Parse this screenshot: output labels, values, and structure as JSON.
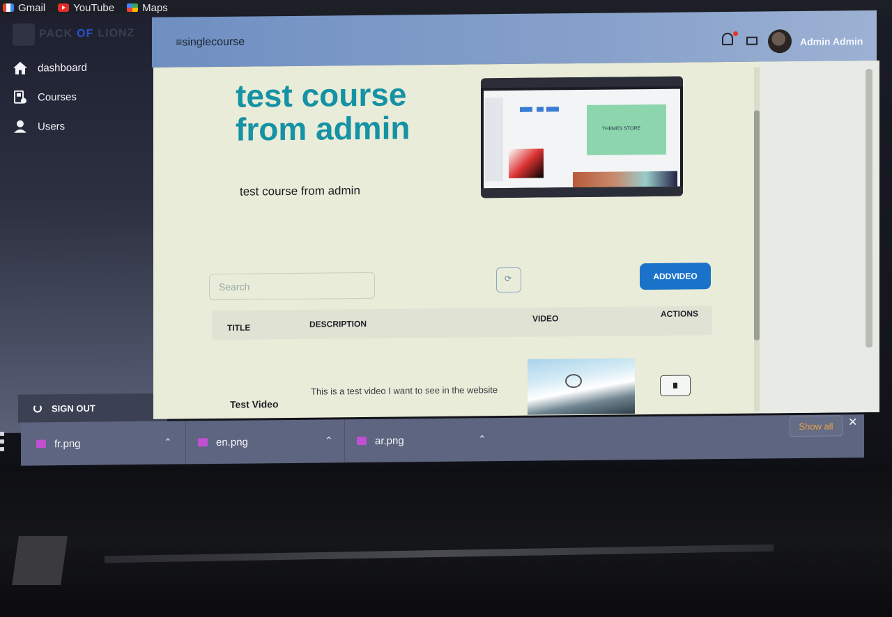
{
  "bookmarks": [
    {
      "label": "Gmail",
      "icon": "gmail-icon"
    },
    {
      "label": "YouTube",
      "icon": "youtube-icon"
    },
    {
      "label": "Maps",
      "icon": "maps-icon"
    }
  ],
  "sidebar": {
    "logo_text_a": "PACK",
    "logo_text_b": "OF",
    "logo_text_c": "LIONZ",
    "items": [
      {
        "label": "dashboard",
        "icon": "home-icon"
      },
      {
        "label": "Courses",
        "icon": "courses-icon"
      },
      {
        "label": "Users",
        "icon": "user-icon"
      }
    ],
    "signout_label": "SIGN OUT"
  },
  "header": {
    "title": "≡singlecourse",
    "user_name": "Admin Admin",
    "notification_color": "#e5342b"
  },
  "course": {
    "title": "test course from admin",
    "description": "test course from admin",
    "thumbnail_store_text": "THEMES STORE"
  },
  "search": {
    "placeholder": "Search"
  },
  "actions": {
    "add_video_label": "ADDVIDEO"
  },
  "table": {
    "headers": [
      "TITLE",
      "DESCRIPTION",
      "VIDEO",
      "ACTIONS"
    ],
    "rows": [
      {
        "title": "Test Video",
        "description": "This is a test video I want to see in the website"
      }
    ]
  },
  "downloads": {
    "items": [
      {
        "name": "fr.png"
      },
      {
        "name": "en.png"
      },
      {
        "name": "ar.png"
      }
    ],
    "show_all_label": "Show all",
    "close_label": "✕"
  },
  "colors": {
    "accent": "#1592a4",
    "primary_button": "#1a73c9",
    "header": "#7f99c6"
  }
}
